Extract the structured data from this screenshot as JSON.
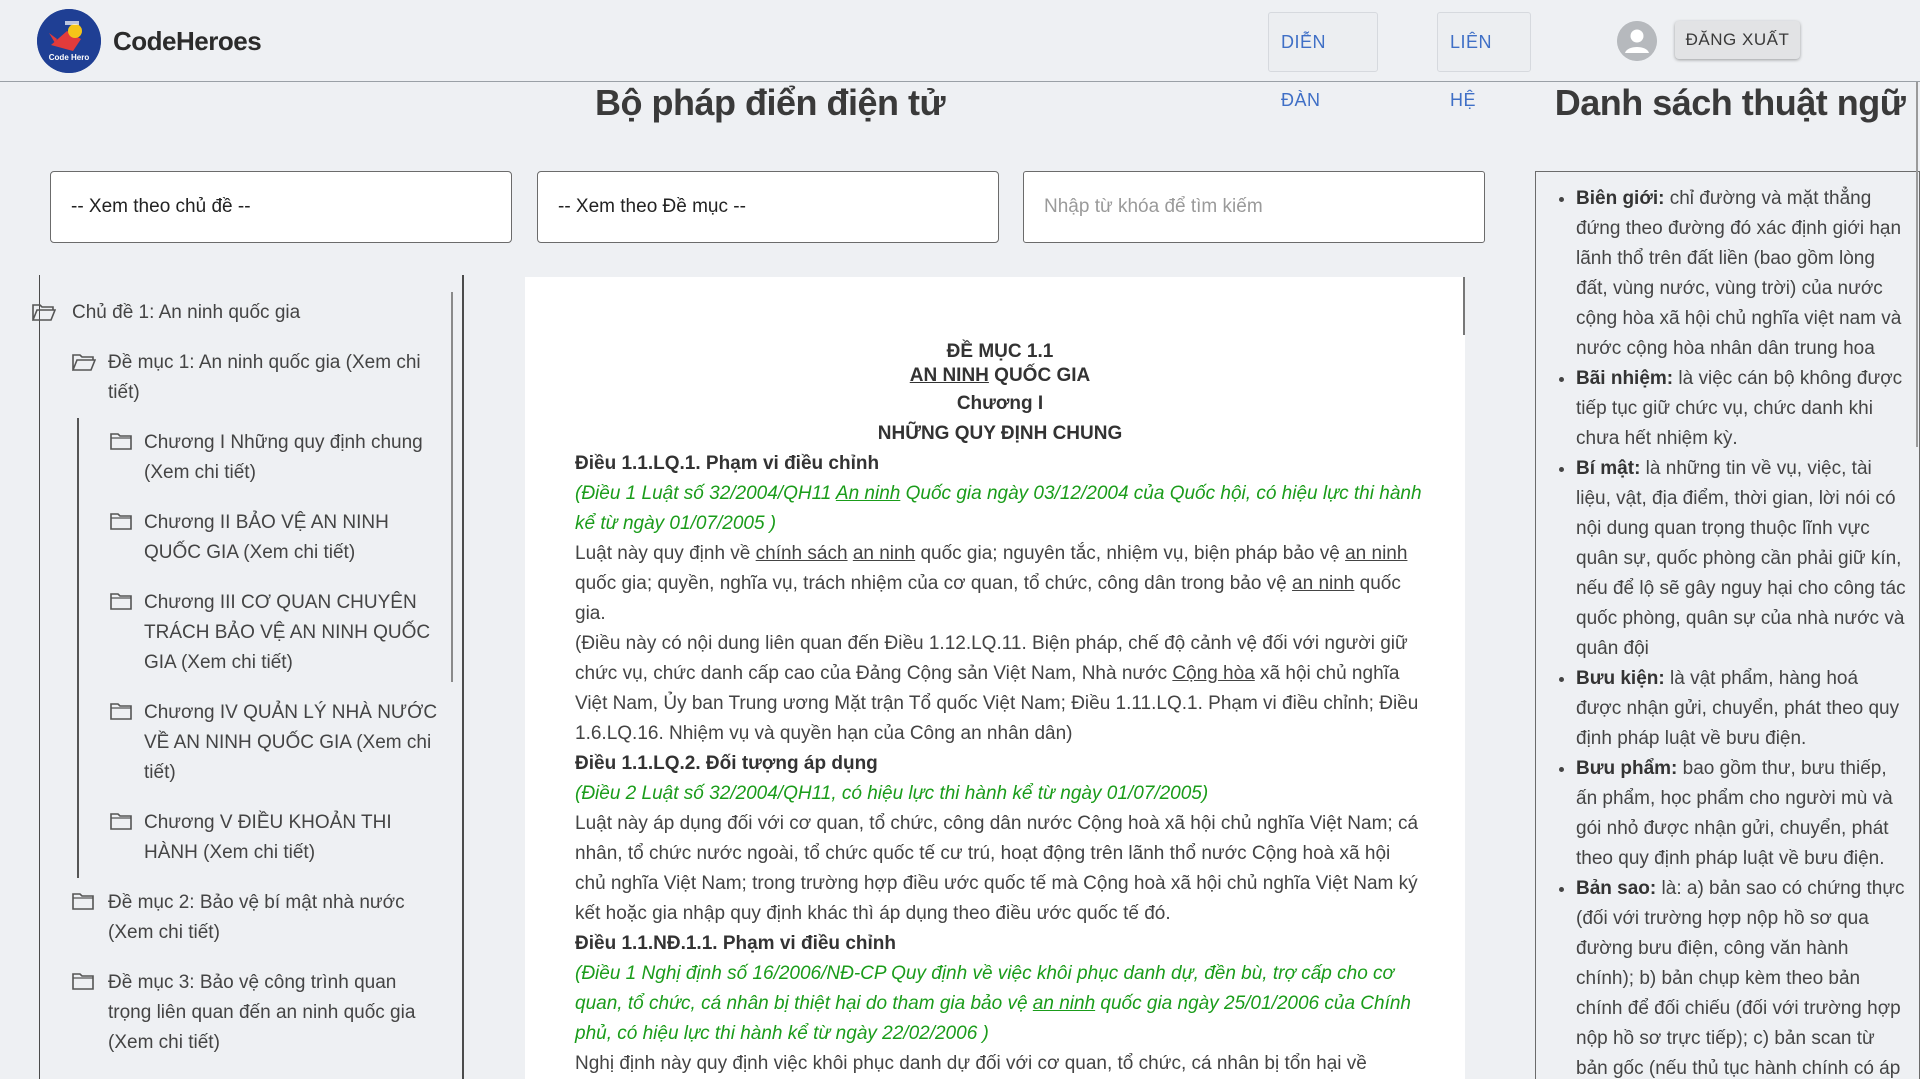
{
  "header": {
    "brand": "CodeHeroes",
    "logo_text": "Code Hero",
    "nav_forum": "DIỄN ĐÀN",
    "nav_contact": "LIÊN HỆ",
    "logout": "ĐĂNG XUẤT"
  },
  "main": {
    "title": "Bộ pháp điển điện tử",
    "filter_topic": "-- Xem theo chủ đề --",
    "filter_section": "-- Xem theo Đề mục --",
    "search_placeholder": "Nhập từ khóa để tìm kiếm"
  },
  "tree": {
    "topic": "Chủ đề 1: An ninh quốc gia",
    "sections": [
      {
        "label": "Đề mục 1: An ninh quốc gia (Xem chi tiết)"
      },
      {
        "label": "Đề mục 2: Bảo vệ bí mật nhà nước (Xem chi tiết)"
      },
      {
        "label": "Đề mục 3: Bảo vệ công trình quan trọng liên quan đến an ninh quốc gia (Xem chi tiết)"
      }
    ],
    "chapters": [
      {
        "label": "Chương I Những quy định chung (Xem chi tiết)"
      },
      {
        "label": "Chương II BẢO VỆ AN NINH QUỐC GIA (Xem chi tiết)"
      },
      {
        "label": "Chương III CƠ QUAN CHUYÊN TRÁCH BẢO VỆ AN NINH QUỐC GIA (Xem chi tiết)"
      },
      {
        "label": "Chương IV QUẢN LÝ NHÀ NƯỚC VỀ AN NINH QUỐC GIA (Xem chi tiết)"
      },
      {
        "label": "Chương V ĐIỀU KHOẢN THI HÀNH (Xem chi tiết)"
      }
    ]
  },
  "document": {
    "heading_section": "ĐỀ MỤC 1.1",
    "heading_name_link": "AN NINH",
    "heading_name_rest": " QUỐC GIA",
    "heading_chapter": "Chương I",
    "heading_chapter_name": "NHỮNG QUY ĐỊNH CHUNG",
    "art1_title": "Điều 1.1.LQ.1. Phạm vi điều chỉnh",
    "art1_src_a": "(Điều 1 Luật số 32/2004/QH11 ",
    "art1_src_link": "An ninh",
    "art1_src_b": " Quốc gia ngày 03/12/2004 của Quốc hội, có hiệu lực thi hành kể từ ngày 01/07/2005 )",
    "art1_body_a": "Luật này quy định về ",
    "art1_body_link1": "chính sách",
    "art1_body_b": " ",
    "art1_body_link2": "an ninh",
    "art1_body_c": " quốc gia; nguyên tắc, nhiệm vụ, biện pháp bảo vệ ",
    "art1_body_link3": "an ninh",
    "art1_body_d": " quốc gia; quyền, nghĩa vụ, trách nhiệm của cơ quan, tổ chức, công dân trong bảo vệ ",
    "art1_body_link4": "an ninh",
    "art1_body_e": " quốc gia.",
    "art1_related_a": "(Điều này có nội dung liên quan đến Điều 1.12.LQ.11. Biện pháp, chế độ cảnh vệ đối với người giữ chức vụ, chức danh cấp cao của Đảng Cộng sản Việt Nam, Nhà nước ",
    "art1_related_link": "Cộng hòa",
    "art1_related_b": " xã hội chủ nghĩa Việt Nam, Ủy ban Trung ương Mặt trận Tổ quốc Việt Nam; Điều 1.11.LQ.1. Phạm vi điều chỉnh; Điều 1.6.LQ.16. Nhiệm vụ và quyền hạn của Công an nhân dân)",
    "art2_title": "Điều 1.1.LQ.2. Đối tượng áp dụng",
    "art2_src": "(Điều 2 Luật số 32/2004/QH11, có hiệu lực thi hành kể từ ngày 01/07/2005)",
    "art2_body": "Luật này áp dụng đối với cơ quan, tổ chức, công dân nước Cộng hoà xã hội chủ nghĩa Việt Nam; cá nhân, tổ chức nước ngoài, tổ chức quốc tế cư trú, hoạt động trên lãnh thổ nước Cộng hoà xã hội chủ nghĩa Việt Nam; trong trường hợp điều ước quốc tế mà Cộng hoà xã hội chủ nghĩa Việt Nam ký kết hoặc gia nhập quy định khác thì áp dụng theo điều ước quốc tế đó.",
    "art3_title": "Điều 1.1.NĐ.1.1. Phạm vi điều chỉnh",
    "art3_src_a": "(Điều 1 Nghị định số 16/2006/NĐ-CP Quy định về việc khôi phục danh dự, đền bù, trợ cấp cho cơ quan, tổ chức, cá nhân bị thiệt hại do tham gia bảo vệ ",
    "art3_src_link": "an ninh",
    "art3_src_b": " quốc gia ngày 25/01/2006 của Chính phủ, có hiệu lực thi hành kể từ ngày 22/02/2006 )",
    "art3_body": "Nghị định này quy định việc khôi phục danh dự đối với cơ quan, tổ chức, cá nhân bị tổn hại về"
  },
  "glossary": {
    "title": "Danh sách thuật ngữ",
    "terms": [
      {
        "term": "Biên giới:",
        "def": " chỉ đường và mặt thẳng đứng theo đường đó xác định giới hạn lãnh thổ trên đất liền (bao gồm lòng đất, vùng nước, vùng trời) của nước cộng hòa xã hội chủ nghĩa việt nam và nước cộng hòa nhân dân trung hoa"
      },
      {
        "term": "Bãi nhiệm:",
        "def": " là việc cán bộ không được tiếp tục giữ chức vụ, chức danh khi chưa hết nhiệm kỳ."
      },
      {
        "term": "Bí mật:",
        "def": " là những tin về vụ, việc, tài liệu, vật, địa điểm, thời gian, lời nói có nội dung quan trọng thuộc lĩnh vực quân sự, quốc phòng cần phải giữ kín, nếu để lộ sẽ gây nguy hại cho công tác quốc phòng, quân sự của nhà nước và quân đội"
      },
      {
        "term": "Bưu kiện:",
        "def": " là vật phẩm, hàng hoá được nhận gửi, chuyển, phát theo quy định pháp luật về bưu điện."
      },
      {
        "term": "Bưu phẩm:",
        "def": " bao gồm thư, bưu thiếp, ấn phẩm, học phẩm cho người mù và gói nhỏ được nhận gửi, chuyển, phát theo quy định pháp luật về bưu điện."
      },
      {
        "term": "Bản sao:",
        "def": " là: a) bản sao có chứng thực (đối với trường hợp nộp hồ sơ qua đường bưu điện, công văn hành chính); b) bản chụp kèm theo bản chính để đối chiếu (đối với trường hợp nộp hồ sơ trực tiếp); c) bản scan từ bản gốc (nếu thủ tục hành chính có áp dụng nộp hồ sơ qua mạng điện tử)."
      }
    ]
  },
  "colors": {
    "accent_link": "#3f6fc6",
    "source_green": "#1a9c1a",
    "logo_blue": "#1f3f94"
  }
}
